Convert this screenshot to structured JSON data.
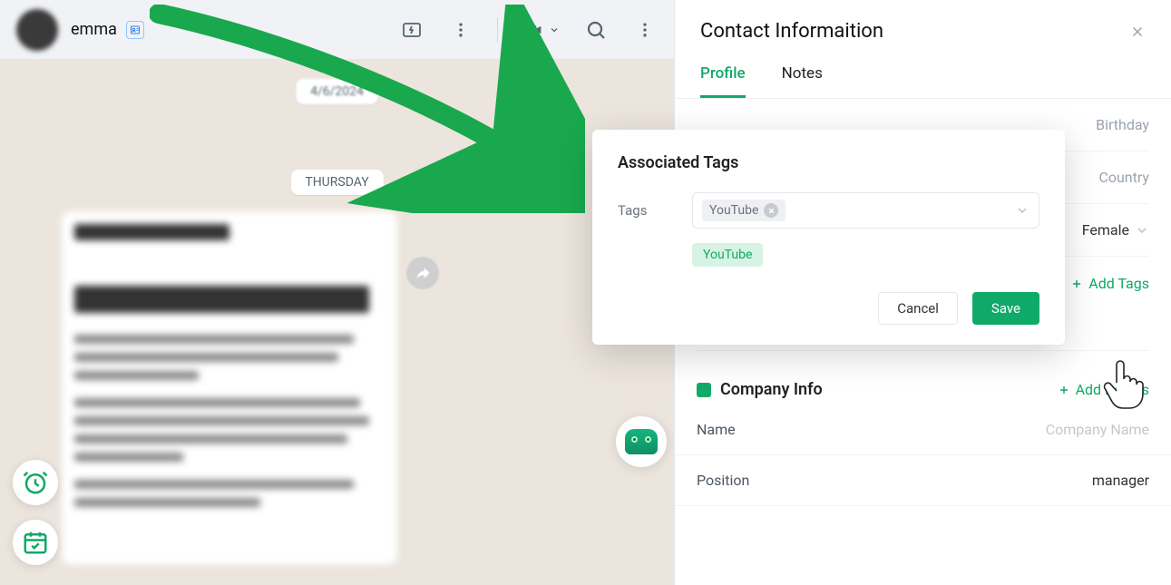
{
  "chat": {
    "contactName": "emma",
    "date1": "4/6/2024",
    "date2": "THURSDAY"
  },
  "panel": {
    "title": "Contact Informaition",
    "tabs": {
      "profile": "Profile",
      "notes": "Notes"
    },
    "fields": {
      "birthdayPlaceholder": "Birthday",
      "countryPlaceholder": "Country",
      "genderValue": "Female"
    },
    "addTags": "Add Tags",
    "tagChip": "YouTube",
    "company": {
      "title": "Company Info",
      "addDetails": "Add Details",
      "nameLabel": "Name",
      "namePlaceholder": "Company Name",
      "positionLabel": "Position",
      "positionValue": "manager"
    }
  },
  "modal": {
    "title": "Associated Tags",
    "tagsLabel": "Tags",
    "selectedTag": "YouTube",
    "suggestedTag": "YouTube",
    "cancel": "Cancel",
    "save": "Save"
  }
}
